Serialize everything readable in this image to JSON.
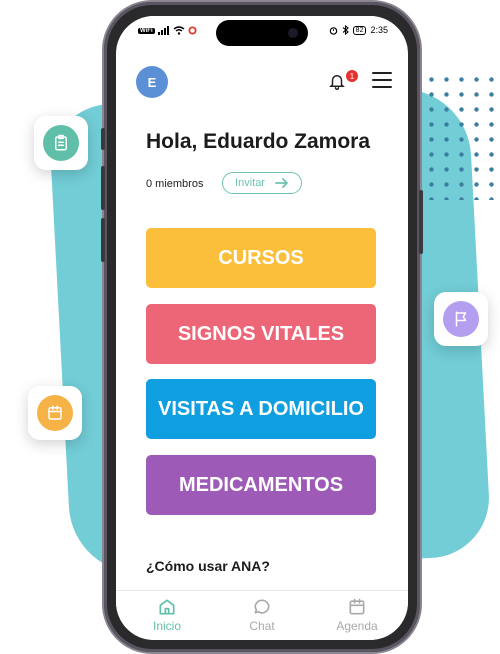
{
  "status_bar": {
    "wifi_badge": "WiFi",
    "time": "2:35",
    "battery": "82"
  },
  "header": {
    "avatar_initial": "E",
    "notification_count": "1"
  },
  "greeting": "Hola, Eduardo Zamora",
  "members": {
    "count_text": "0 miembros",
    "invite_label": "Invitar"
  },
  "modules": [
    {
      "label": "CURSOS",
      "color": "#fbbf3b"
    },
    {
      "label": "SIGNOS VITALES",
      "color": "#ed6677"
    },
    {
      "label": "VISITAS A DOMICILIO",
      "color": "#0f9ee0"
    },
    {
      "label": "MEDICAMENTOS",
      "color": "#9d5bb7"
    }
  ],
  "help_heading": "¿Cómo usar ANA?",
  "bottom_nav": [
    {
      "label": "Inicio",
      "icon": "home-icon",
      "active": true
    },
    {
      "label": "Chat",
      "icon": "chat-icon",
      "active": false
    },
    {
      "label": "Agenda",
      "icon": "calendar-icon",
      "active": false
    }
  ],
  "decorations": {
    "left_card_icon": "clipboard-icon",
    "right_card_icon": "flag-icon",
    "lower_left_card_icon": "calendar-icon",
    "accent_teal": "#72cdd6",
    "accent_green": "#5fbfa8"
  }
}
